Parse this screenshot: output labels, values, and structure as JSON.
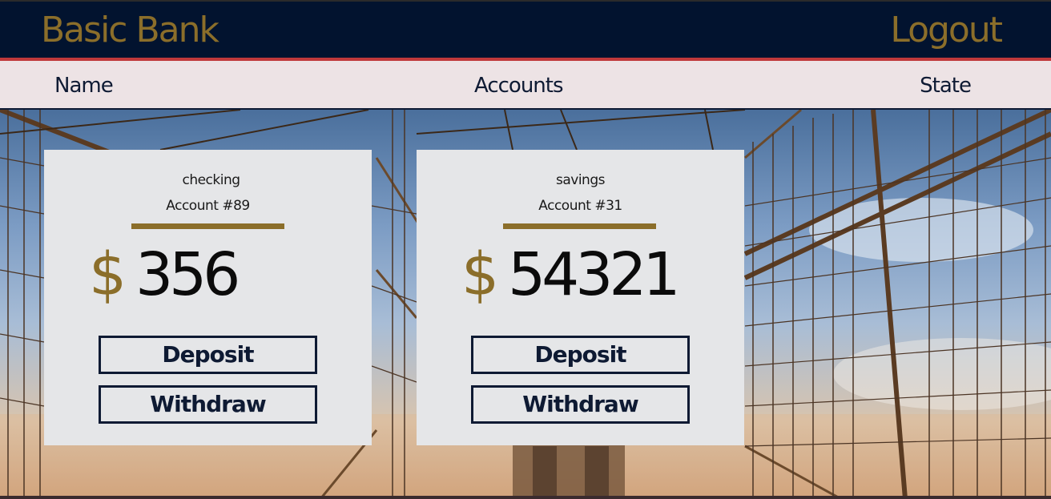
{
  "header": {
    "brand": "Basic Bank",
    "logout_label": "Logout"
  },
  "nav": {
    "items": [
      {
        "label": "Name"
      },
      {
        "label": "Accounts"
      },
      {
        "label": "State"
      }
    ]
  },
  "accounts": [
    {
      "type": "checking",
      "number_label": "Account #89",
      "currency_symbol": "$",
      "balance": "356",
      "deposit_label": "Deposit",
      "withdraw_label": "Withdraw"
    },
    {
      "type": "savings",
      "number_label": "Account #31",
      "currency_symbol": "$",
      "balance": "54321",
      "deposit_label": "Deposit",
      "withdraw_label": "Withdraw"
    }
  ],
  "colors": {
    "header_bg": "#02132f",
    "accent_gold": "#8b6e2a",
    "accent_red": "#c0393b",
    "nav_bg": "#ede3e5",
    "card_bg": "#e5e6e8",
    "text_dark": "#0e1a33"
  },
  "background": {
    "icon": "bridge-cables-photo"
  }
}
